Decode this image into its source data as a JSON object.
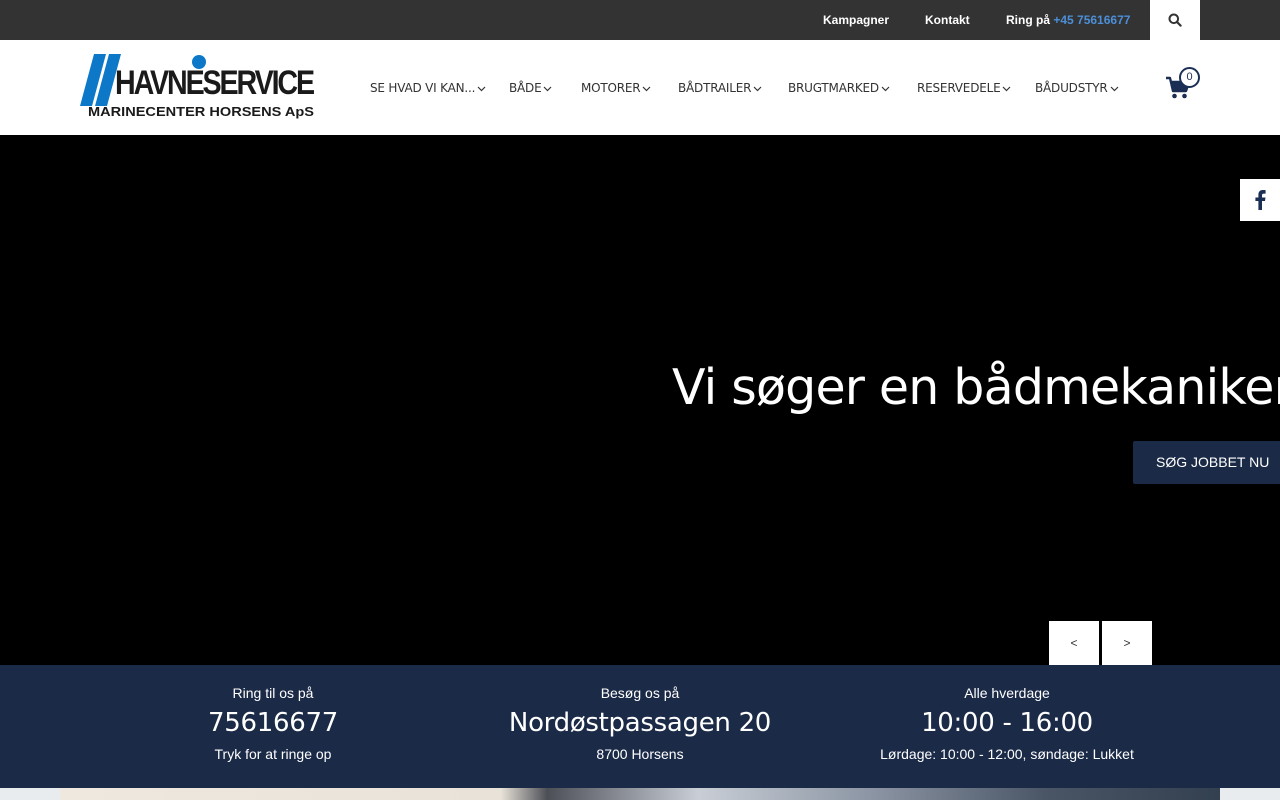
{
  "topbar": {
    "links": [
      "Kampagner",
      "Kontakt"
    ],
    "call_prefix": "Ring på ",
    "call_number": "+45 75616677",
    "search_icon": "search-icon"
  },
  "header": {
    "logo_text": "HAVNESERVICE",
    "logo_subtext": "MARINECENTER HORSENS ApS",
    "nav": [
      "SE HVAD VI KAN...",
      "BÅDE",
      "MOTORER",
      "BÅDTRAILER",
      "BRUGTMARKED",
      "RESERVEDELE",
      "BÅDUDSTYR"
    ],
    "cart_count": "0"
  },
  "hero": {
    "title": "Vi søger en bådmekaniker",
    "cta": "SØG JOBBET NU",
    "prev": "<",
    "next": ">"
  },
  "info": {
    "phone_label": "Ring til os på",
    "phone_value": "75616677",
    "phone_note": "Tryk for at ringe op",
    "visit_label": "Besøg os på",
    "visit_value": "Nordøstpassagen 20",
    "visit_note": "8700 Horsens",
    "hours_label": "Alle hverdage",
    "hours_value": "10:00 - 16:00",
    "hours_note": "Lørdage: 10:00 - 12:00, søndage: Lukket"
  },
  "colors": {
    "topbar": "#333333",
    "accent_blue": "#4c8fd8",
    "navy": "#1b2a47",
    "logo_blue": "#0e78c8"
  }
}
